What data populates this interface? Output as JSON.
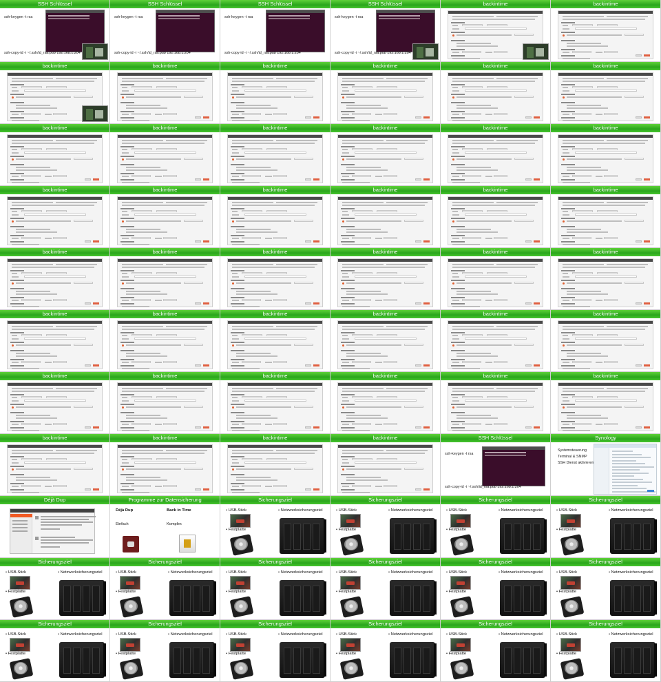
{
  "texts": {
    "ssh_title": "SSH Schlüssel",
    "ssh_cmd1": "ssh-keygen -t rsa",
    "ssh_cmd2": "ssh-copy-id -i ~/.ssh/id_rsa.pub 192.168.1.204",
    "backintime_title": "backintime",
    "synology_title": "Synology",
    "synology_lines": [
      "Systemsteuerung",
      "Terminal & SNMP",
      "SSH Dienst aktivieren"
    ],
    "dejadup_title": "Déjà Dup",
    "programme_title": "Programme zur Datensicherung",
    "programme_left_heading": "Déjà Dup",
    "programme_left_sub": "Einfach",
    "programme_right_heading": "Back in Time",
    "programme_right_sub": "Komplex",
    "ziel_title": "Sicherungsziel",
    "ziel_usb": "USB-Stick",
    "ziel_hdd": "Festplatte",
    "ziel_nas": "Netzwerksicherungsziel"
  },
  "slides": [
    {
      "type": "ssh",
      "thumb": true
    },
    {
      "type": "ssh",
      "thumb": false
    },
    {
      "type": "ssh",
      "thumb": false
    },
    {
      "type": "ssh",
      "thumb": true
    },
    {
      "type": "backintime",
      "thumb": true
    },
    {
      "type": "backintime",
      "thumb": false
    },
    {
      "type": "backintime",
      "thumb": true
    },
    {
      "type": "backintime",
      "thumb": false
    },
    {
      "type": "backintime",
      "thumb": false
    },
    {
      "type": "backintime",
      "thumb": false
    },
    {
      "type": "backintime",
      "thumb": false
    },
    {
      "type": "backintime",
      "thumb": false
    },
    {
      "type": "backintime"
    },
    {
      "type": "backintime"
    },
    {
      "type": "backintime"
    },
    {
      "type": "backintime"
    },
    {
      "type": "backintime"
    },
    {
      "type": "backintime"
    },
    {
      "type": "backintime"
    },
    {
      "type": "backintime"
    },
    {
      "type": "backintime"
    },
    {
      "type": "backintime"
    },
    {
      "type": "backintime"
    },
    {
      "type": "backintime"
    },
    {
      "type": "backintime"
    },
    {
      "type": "backintime"
    },
    {
      "type": "backintime"
    },
    {
      "type": "backintime"
    },
    {
      "type": "backintime"
    },
    {
      "type": "backintime"
    },
    {
      "type": "backintime"
    },
    {
      "type": "backintime"
    },
    {
      "type": "backintime"
    },
    {
      "type": "backintime"
    },
    {
      "type": "backintime"
    },
    {
      "type": "backintime"
    },
    {
      "type": "backintime"
    },
    {
      "type": "backintime"
    },
    {
      "type": "backintime"
    },
    {
      "type": "backintime"
    },
    {
      "type": "backintime"
    },
    {
      "type": "backintime"
    },
    {
      "type": "backintime"
    },
    {
      "type": "backintime"
    },
    {
      "type": "backintime"
    },
    {
      "type": "backintime"
    },
    {
      "type": "ssh_small"
    },
    {
      "type": "synology"
    },
    {
      "type": "dejadup"
    },
    {
      "type": "programme"
    },
    {
      "type": "ziel"
    },
    {
      "type": "ziel"
    },
    {
      "type": "ziel"
    },
    {
      "type": "ziel"
    },
    {
      "type": "ziel"
    },
    {
      "type": "ziel"
    },
    {
      "type": "ziel"
    },
    {
      "type": "ziel"
    },
    {
      "type": "ziel"
    },
    {
      "type": "ziel"
    },
    {
      "type": "ziel"
    },
    {
      "type": "ziel"
    },
    {
      "type": "ziel"
    },
    {
      "type": "ziel"
    },
    {
      "type": "ziel"
    },
    {
      "type": "ziel"
    }
  ]
}
